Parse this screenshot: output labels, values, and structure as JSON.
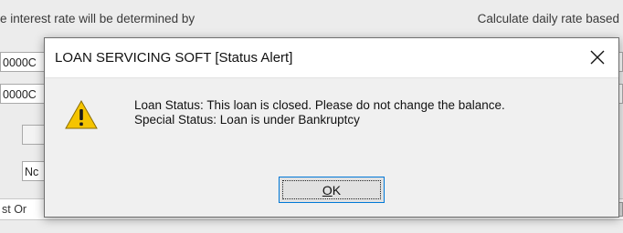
{
  "background": {
    "left_text": "e interest rate will be determined by",
    "right_text": "Calculate daily rate based",
    "field1_value": "0000C",
    "field2_value": "0000C",
    "field4_value": "Nc",
    "bottom_row_text": "st Or"
  },
  "dialog": {
    "title": "LOAN SERVICING SOFT [Status Alert]",
    "icon": "warning-icon",
    "message_line1": "Loan Status: This loan is closed. Please do not change the balance.",
    "message_line2": "Special Status: Loan is under Bankruptcy",
    "ok_mnemonic": "O",
    "ok_rest": "K",
    "accent_color": "#0078d7",
    "warning_color": "#f5c400"
  }
}
